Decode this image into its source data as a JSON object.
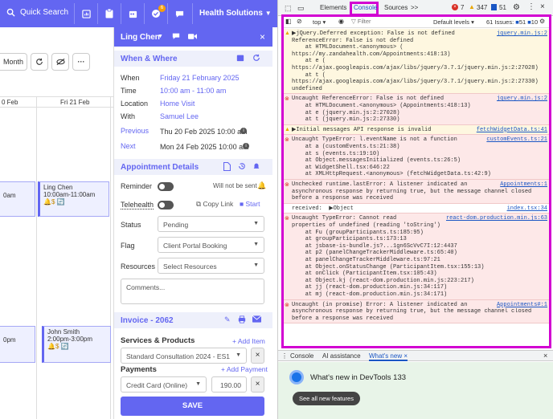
{
  "nav": {
    "search_label": "Quick Search",
    "notif_count": "6",
    "org_name": "Health Solutions"
  },
  "calendar": {
    "month_btn": "Month",
    "col1": "0 Feb",
    "col2": "Fri 21 Feb",
    "events": [
      {
        "line1": "0am"
      },
      {
        "line1": "Ling Chen",
        "line2": "10:00am-11:00am",
        "line3": "🔔$ 🔄"
      },
      {
        "line1": "0pm"
      },
      {
        "line1": "John Smith",
        "line2": "2:00pm-3:00pm",
        "line3": "🔔$ 🔄"
      }
    ]
  },
  "panel": {
    "patient": "Ling Chen",
    "when_where": "When & Where",
    "rows": [
      {
        "label": "When",
        "value": "Friday 21 February 2025"
      },
      {
        "label": "Time",
        "value": "10:00 am - 11:00 am"
      },
      {
        "label": "Location",
        "value": "Home Visit"
      },
      {
        "label": "With",
        "value": "Samuel Lee"
      }
    ],
    "previous_label": "Previous",
    "previous_value": "Thu 20 Feb 2025 10:00 am",
    "next_label": "Next",
    "next_value": "Mon 24 Feb 2025 10:00 am",
    "appt_details": "Appointment Details",
    "reminder_label": "Reminder",
    "reminder_note": "Will not be sent",
    "telehealth_label": "Telehealth",
    "copy_link": "Copy Link",
    "start": "Start",
    "status_label": "Status",
    "status_value": "Pending",
    "flag_label": "Flag",
    "flag_value": "Client Portal Booking",
    "resources_label": "Resources",
    "resources_placeholder": "Select Resources",
    "comments_placeholder": "Comments...",
    "invoice_title": "Invoice - 2062",
    "services_label": "Services & Products",
    "add_item": "+ Add Item",
    "service_value": "Standard Consultation 2024 - ES1",
    "payments_label": "Payments",
    "add_payment": "+ Add Payment",
    "payment_method": "Credit Card (Online)",
    "payment_amount": "190.00",
    "save_label": "SAVE"
  },
  "devtools": {
    "tabs": [
      "Elements",
      "Console",
      "Sources"
    ],
    "more": ">>",
    "err_count": "7",
    "warn_count": "347",
    "info_count": "51",
    "context": "top",
    "filter_placeholder": "Filter",
    "levels": "Default levels",
    "issues": "61 Issues:",
    "issues_count": "51",
    "issues_info": "10",
    "drawer_tabs": [
      "Console",
      "AI assistance",
      "What's new"
    ],
    "whatsnew_title": "What's new in DevTools 133",
    "see_all": "See all new features",
    "messages": [
      {
        "kind": "warn",
        "lines": [
          "▶jQuery.Deferred exception: False is not defined",
          "ReferenceError: False is not defined",
          "    at HTMLDocument.<anonymous> (",
          "https://my.zandahealth.com/Appointments:418:13)",
          "    at e (",
          "https://ajax.googleapis.com/ajax/libs/jquery/3.7.1/jquery.min.js:2:27028)",
          "    at t (",
          "https://ajax.googleapis.com/ajax/libs/jquery/3.7.1/jquery.min.js:2:27330)",
          "undefined"
        ],
        "src": "jquery.min.js:2"
      },
      {
        "kind": "err",
        "lines": [
          "Uncaught ReferenceError: False is not defined",
          "    at HTMLDocument.<anonymous> (Appointments:418:13)",
          "    at e (jquery.min.js:2:27028)",
          "    at t (jquery.min.js:2:27330)"
        ],
        "src": "jquery.min.js:2"
      },
      {
        "kind": "warn",
        "lines": [
          "▶Initial messages API response is invalid"
        ],
        "src": "fetchWidgetData.ts:41"
      },
      {
        "kind": "err",
        "lines": [
          "Uncaught TypeError: l.eventName is not a function",
          "    at a (customEvents.ts:21:38)",
          "    at s (events.ts:19:10)",
          "    at Object.messagesInitialized (events.ts:26:5)",
          "    at WidgetShell.tsx:646:22",
          "    at XMLHttpRequest.<anonymous> (fetchWidgetData.ts:42:9)"
        ],
        "src": "customEvents.ts:21"
      },
      {
        "kind": "err",
        "lines": [
          "Unchecked runtime.lastError: A listener indicated an",
          "asynchronous response by returning true, but the message channel closed",
          "before a response was received"
        ],
        "src": "Appointments:1"
      },
      {
        "kind": "plain",
        "lines": [
          "received:  ▶Object"
        ],
        "src": "index.tsx:34"
      },
      {
        "kind": "err",
        "lines": [
          "Uncaught TypeError: Cannot read",
          "properties of undefined (reading 'toString')",
          "    at Fu (groupParticipants.ts:185:95)",
          "    at groupParticipants.ts:173:13",
          "    at jsbase-is-bundle.js?...1gn6ScVvC7I:12:4437",
          "    at p2 (panelChangeTrackerMiddleware.ts:65:40)",
          "    at panelChangeTrackerMiddleware.ts:97:21",
          "    at Object.onStatusChange (ParticipantItem.tsx:155:13)",
          "    at onClick (ParticipantItem.tsx:105:43)",
          "    at Object.kj (react-dom.production.min.js:223:217)",
          "    at jj (react-dom.production.min.js:34:117)",
          "    at mj (react-dom.production.min.js:34:171)"
        ],
        "src": "react-dom.production.min.js:63"
      },
      {
        "kind": "err",
        "lines": [
          "Uncaught (in promise) Error: A listener indicated an",
          "asynchronous response by returning true, but the message channel closed",
          "before a response was received"
        ],
        "src": "Appointments#:1"
      }
    ]
  }
}
